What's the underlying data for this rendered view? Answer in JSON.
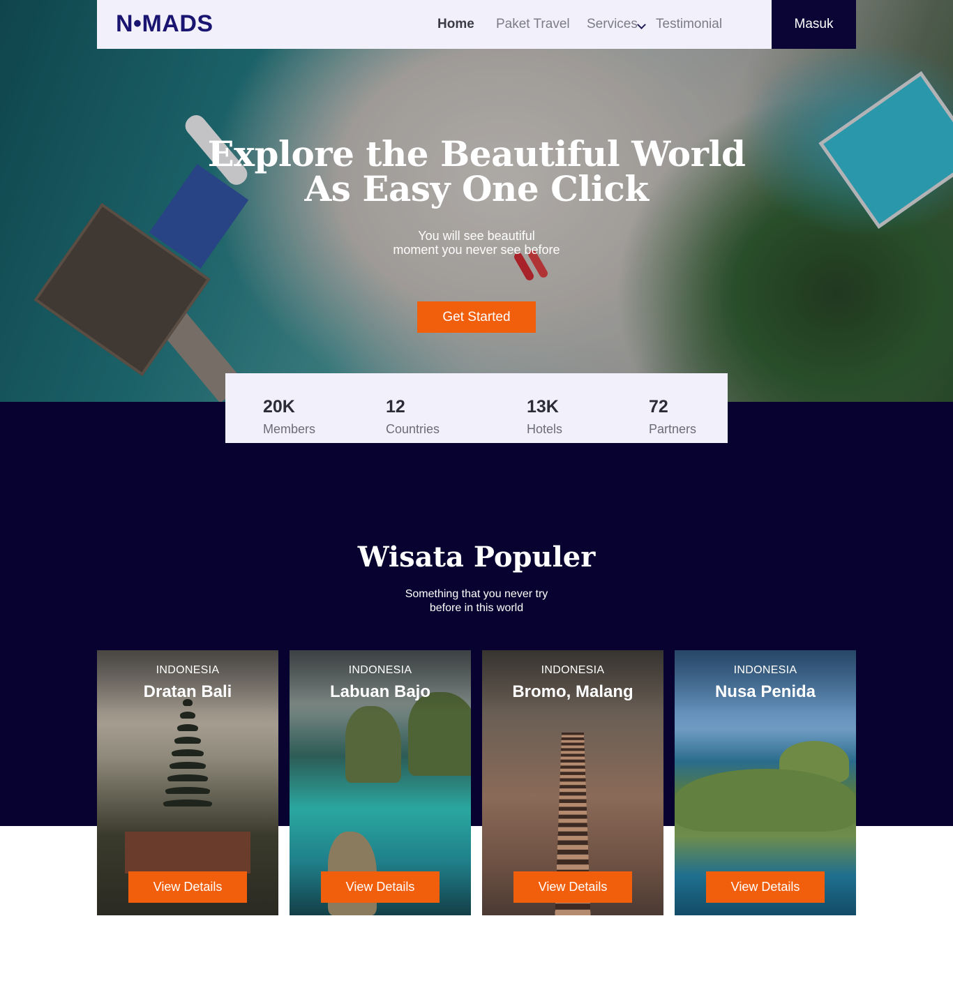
{
  "brand": {
    "logo_text": "N•MADS",
    "accent_color": "#f25f0c",
    "dark_color": "#07022f",
    "nav_bg": "#f1f0fb"
  },
  "nav": {
    "links": [
      "Home",
      "Paket Travel",
      "Services",
      "Testimonial"
    ],
    "login_label": "Masuk"
  },
  "hero": {
    "title_line1": "Explore the Beautiful World",
    "title_line2": "As Easy One Click",
    "subtitle_line1": "You will see beautiful",
    "subtitle_line2": "moment you never see before",
    "cta_label": "Get Started"
  },
  "stats": [
    {
      "value": "20K",
      "label": "Members"
    },
    {
      "value": "12",
      "label": "Countries"
    },
    {
      "value": "13K",
      "label": "Hotels"
    },
    {
      "value": "72",
      "label": "Partners"
    }
  ],
  "popular": {
    "title": "Wisata Populer",
    "subtitle_line1": "Something that you never try",
    "subtitle_line2": "before in this world",
    "cards": [
      {
        "country": "INDONESIA",
        "name": "Dratan Bali",
        "button": "View Details"
      },
      {
        "country": "INDONESIA",
        "name": "Labuan Bajo",
        "button": "View Details"
      },
      {
        "country": "INDONESIA",
        "name": "Bromo, Malang",
        "button": "View Details"
      },
      {
        "country": "INDONESIA",
        "name": "Nusa Penida",
        "button": "View Details"
      }
    ]
  }
}
